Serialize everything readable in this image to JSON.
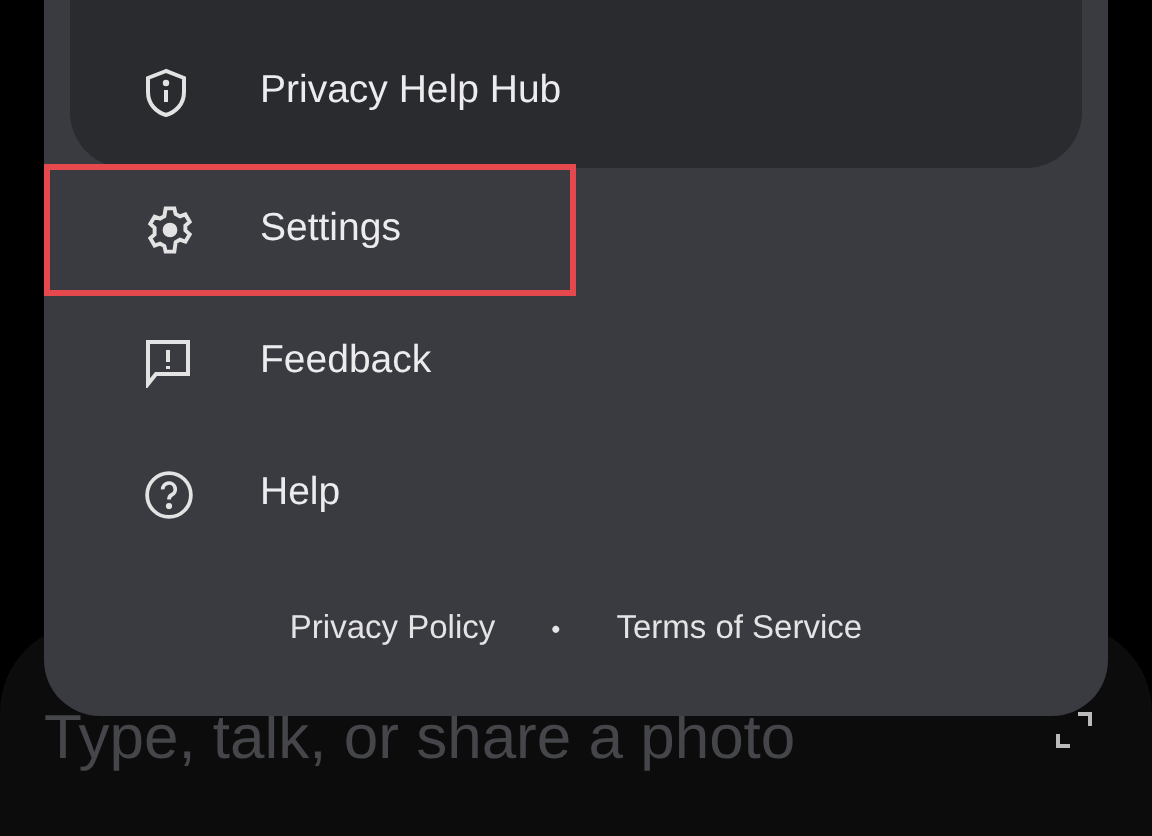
{
  "menu": {
    "items": [
      {
        "kind": "shield",
        "label": "Privacy Help Hub",
        "highlighted": false
      },
      {
        "kind": "gear",
        "label": "Settings",
        "highlighted": true
      },
      {
        "kind": "feedback",
        "label": "Feedback",
        "highlighted": false
      },
      {
        "kind": "help",
        "label": "Help",
        "highlighted": false
      }
    ],
    "footer_links": [
      "Privacy Policy",
      "Terms of Service"
    ],
    "separator": "•"
  },
  "prompt": {
    "placeholder": "Type, talk, or share a photo"
  }
}
